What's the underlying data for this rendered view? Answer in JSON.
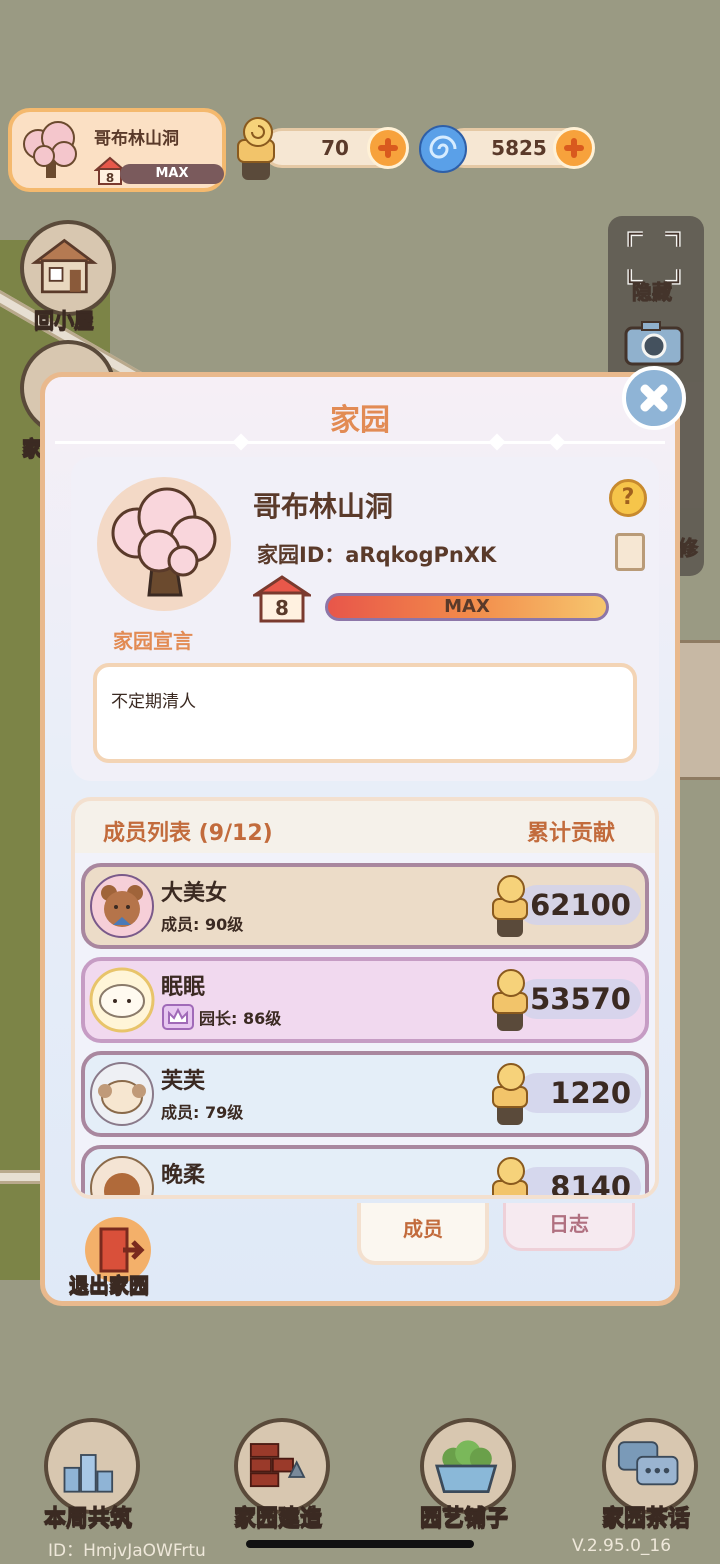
{
  "hud": {
    "garden_name": "哥布林山洞",
    "level": "8",
    "level_bar": "MAX",
    "snail_currency": "70",
    "swirl_currency": "5825"
  },
  "side": {
    "back_home": "回小屋",
    "garden_partial": "家",
    "hide": "隐藏",
    "decorate_partial": "修"
  },
  "modal": {
    "title": "家园",
    "garden_name": "哥布林山洞",
    "garden_id": "家园ID：aRqkogPnXK",
    "level": "8",
    "exp_label": "MAX",
    "declaration_label": "家园宣言",
    "declaration_text": "不定期清人",
    "members_header": "成员列表 (9/12)",
    "contribution_header": "累计贡献",
    "members": [
      {
        "name": "大美女",
        "role": "成员: 90级",
        "contribution": "62100"
      },
      {
        "name": "眠眠",
        "role": "园长: 86级",
        "contribution": "53570"
      },
      {
        "name": "芙芙",
        "role": "成员: 79级",
        "contribution": "1220"
      },
      {
        "name": "晚柔",
        "role": "",
        "contribution": "8140"
      }
    ],
    "tab_members": "成员",
    "tab_log": "日志",
    "exit_label": "退出家园"
  },
  "nav": {
    "weekly_build": "本周共筑",
    "garden_build": "家园建造",
    "garden_shop": "园艺铺子",
    "garden_chat": "家园茶话"
  },
  "footer": {
    "user_id": "ID：HmjvJaOWFrtu",
    "version": "V.2.95.0_16"
  },
  "colors": {
    "modal_title": "#e28b54",
    "accent_orange": "#f7a23c",
    "row_bg_member": "#ecdcc8",
    "row_bg_leader": "#f1d9ef",
    "row_bg_normal": "#e4eef8"
  }
}
